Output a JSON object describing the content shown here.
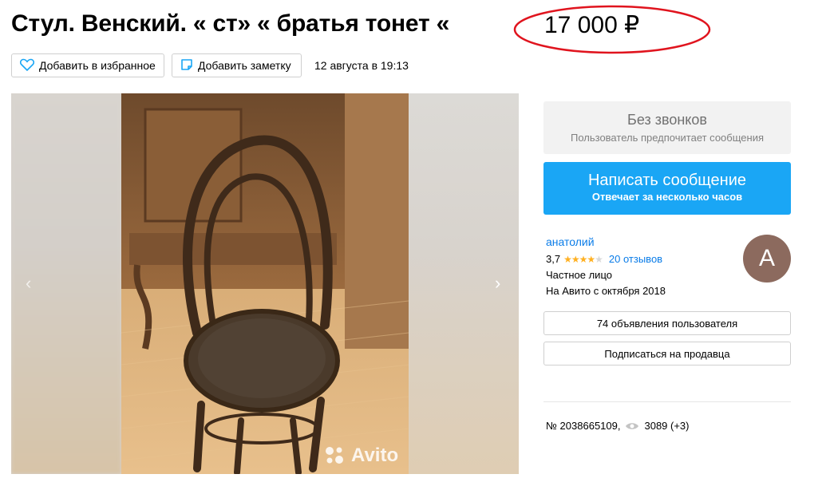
{
  "listing": {
    "title": "Стул. Венский. « ст» « братья тонет «",
    "price": "17 000 ₽",
    "date": "12 августа в 19:13",
    "number": "№ 2038665109,",
    "views": "3089 (+3)"
  },
  "actions": {
    "favorite_label": "Добавить в избранное",
    "note_label": "Добавить заметку"
  },
  "gallery": {
    "watermark": "Avito",
    "prev_icon": "‹",
    "next_icon": "›"
  },
  "contact": {
    "no_calls_title": "Без звонков",
    "no_calls_sub": "Пользователь предпочитает сообщения",
    "message_title": "Написать сообщение",
    "message_sub": "Отвечает за несколько часов"
  },
  "seller": {
    "name": "анатолий",
    "rating": "3,7",
    "rating_value": 3.7,
    "rating_max": 5,
    "reviews": "20 отзывов",
    "type": "Частное лицо",
    "since": "На Авито с октября 2018",
    "avatar_letter": "А",
    "avatar_color": "#8c6a5e",
    "listings_label": "74 объявления пользователя",
    "subscribe_label": "Подписаться на продавца"
  },
  "colors": {
    "primary_button": "#1aa6f5",
    "link": "#0a7ce8",
    "star": "#ffb021",
    "price_annotation": "#e0141e"
  },
  "icons": {
    "favorite": "heart-icon",
    "note": "note-icon",
    "views": "eye-icon",
    "watermark": "avito-logo-icon"
  }
}
